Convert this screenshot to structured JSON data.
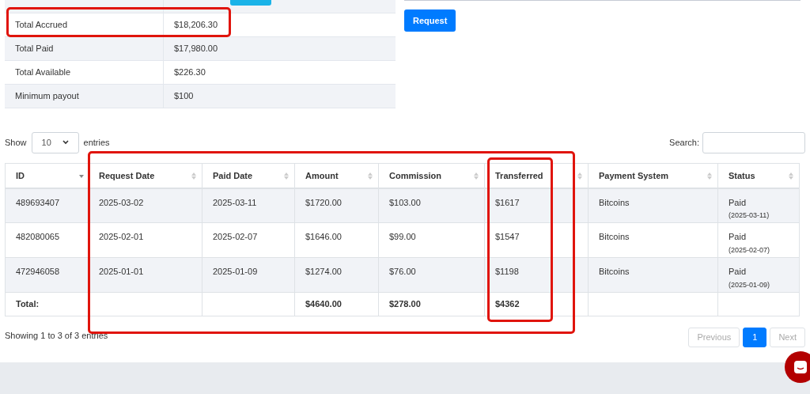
{
  "summary": [
    {
      "label": "Total Accrued",
      "value": "$18,206.30"
    },
    {
      "label": "Total Paid",
      "value": "$17,980.00"
    },
    {
      "label": "Total Available",
      "value": "$226.30"
    },
    {
      "label": "Minimum payout",
      "value": "$100"
    }
  ],
  "request_button": "Request",
  "length_menu": {
    "before": "Show",
    "value": "10",
    "after": "entries"
  },
  "search": {
    "label": "Search:"
  },
  "table": {
    "columns": [
      {
        "label": "ID",
        "sorted": true
      },
      {
        "label": "Request Date",
        "sorted": false
      },
      {
        "label": "Paid Date",
        "sorted": false
      },
      {
        "label": "Amount",
        "sorted": false
      },
      {
        "label": "Commission",
        "sorted": false
      },
      {
        "label": "Transferred",
        "sorted": false
      },
      {
        "label": "Payment System",
        "sorted": false
      },
      {
        "label": "Status",
        "sorted": false
      }
    ],
    "rows": [
      {
        "cells": [
          "489693407",
          "2025-03-02",
          "2025-03-11",
          "$1720.00",
          "$103.00",
          "$1617",
          "Bitcoins"
        ],
        "status": "Paid",
        "status_date": "(2025-03-11)"
      },
      {
        "cells": [
          "482080065",
          "2025-02-01",
          "2025-02-07",
          "$1646.00",
          "$99.00",
          "$1547",
          "Bitcoins"
        ],
        "status": "Paid",
        "status_date": "(2025-02-07)"
      },
      {
        "cells": [
          "472946058",
          "2025-01-01",
          "2025-01-09",
          "$1274.00",
          "$76.00",
          "$1198",
          "Bitcoins"
        ],
        "status": "Paid",
        "status_date": "(2025-01-09)"
      }
    ],
    "total": {
      "label": "Total:",
      "amount": "$4640.00",
      "commission": "$278.00",
      "transferred": "$4362"
    }
  },
  "annotation_frames": [
    {
      "kind": "summary_row"
    },
    {
      "kind": "table_span"
    },
    {
      "kind": "table_column"
    }
  ],
  "info": "Showing 1 to 3 of 3 entries",
  "pagination": [
    {
      "label": "Previous",
      "kind": "prev",
      "disabled": true,
      "selected": false
    },
    {
      "label": "1",
      "kind": "page",
      "disabled": false,
      "selected": true
    },
    {
      "label": "Next",
      "kind": "next",
      "disabled": true,
      "selected": false
    }
  ]
}
